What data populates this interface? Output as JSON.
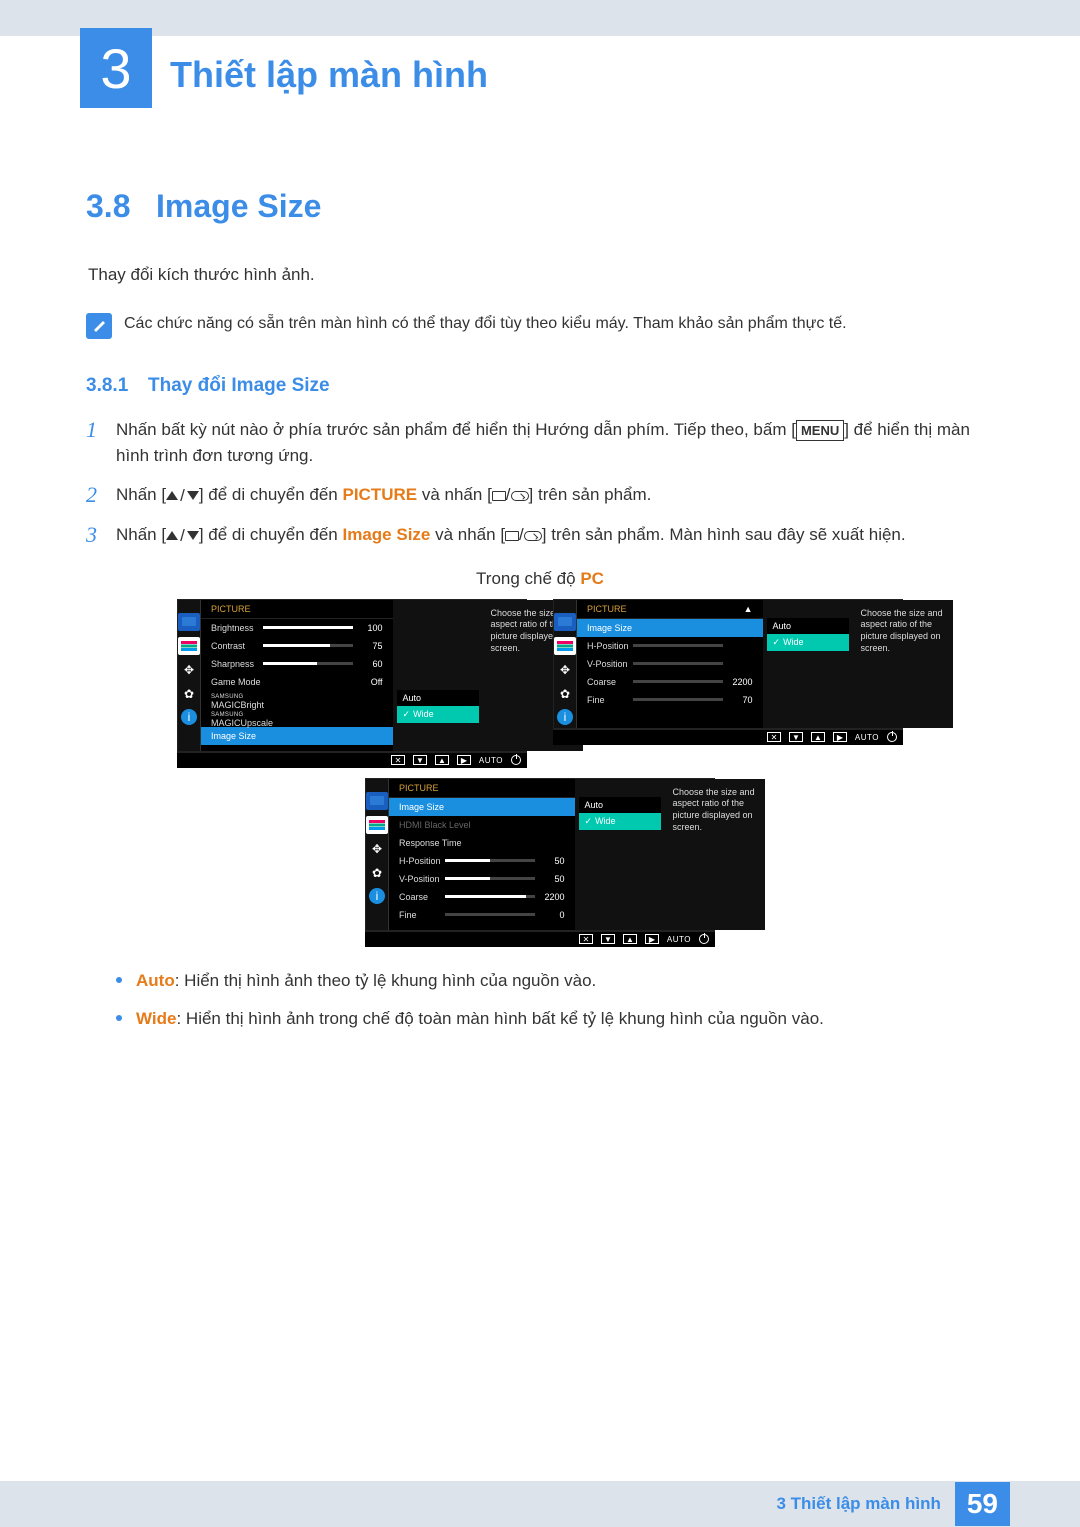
{
  "header": {
    "chapter_number": "3",
    "chapter_title": "Thiết lập màn hình"
  },
  "section": {
    "number": "3.8",
    "title": "Image Size",
    "description": "Thay đổi kích thước hình ảnh.",
    "note": "Các chức năng có sẵn trên màn hình có thể thay đổi tùy theo kiểu máy. Tham khảo sản phẩm thực tế."
  },
  "subsection": {
    "number": "3.8.1",
    "title": "Thay đổi Image Size"
  },
  "steps": {
    "s1_a": "Nhấn bất kỳ nút nào ở phía trước sản phẩm để hiển thị Hướng dẫn phím. Tiếp theo, bấm [",
    "s1_menu": "MENU",
    "s1_b": "] để hiển thị màn hình trình đơn tương ứng.",
    "s2_a": "Nhấn [",
    "s2_b": "] để di chuyển đến ",
    "s2_picture": "PICTURE",
    "s2_c": " và nhấn [",
    "s2_d": "] trên sản phẩm.",
    "s3_a": "Nhấn [",
    "s3_b": "] để di chuyển đến ",
    "s3_image": "Image Size",
    "s3_c": " và nhấn [",
    "s3_d": "] trên sản phẩm. Màn hình sau đây sẽ xuất hiện."
  },
  "mode_line": {
    "prefix": "Trong chế độ ",
    "mode": "PC"
  },
  "osd_desc": "Choose the size and aspect ratio of the picture displayed on screen.",
  "osd_foot_auto": "AUTO",
  "osd1": {
    "title": "PICTURE",
    "rows": [
      {
        "label": "Brightness",
        "bar": 100,
        "value": "100"
      },
      {
        "label": "Contrast",
        "bar": 75,
        "value": "75"
      },
      {
        "label": "Sharpness",
        "bar": 60,
        "value": "60"
      },
      {
        "label": "Game Mode",
        "text": "Off"
      }
    ],
    "magic1": "MAGICBright",
    "magic2": "MAGICUpscale",
    "sel_label": "Image Size",
    "opts": {
      "opt1": "Auto",
      "opt2": "Wide"
    },
    "opt_val": "Auto"
  },
  "osd2": {
    "title": "PICTURE",
    "sel_label": "Image Size",
    "rows": [
      {
        "label": "H-Position"
      },
      {
        "label": "V-Position"
      },
      {
        "label": "Coarse",
        "value": "2200"
      },
      {
        "label": "Fine",
        "value": "70"
      }
    ],
    "opts": {
      "opt1": "Auto",
      "opt2": "Wide"
    }
  },
  "osd3": {
    "title": "PICTURE",
    "sel_label": "Image Size",
    "dim_label": "HDMI Black Level",
    "rows": [
      {
        "label": "Response Time"
      },
      {
        "label": "H-Position",
        "bar": 50,
        "value": "50"
      },
      {
        "label": "V-Position",
        "bar": 50,
        "value": "50"
      },
      {
        "label": "Coarse",
        "value": "2200"
      },
      {
        "label": "Fine",
        "bar": 0,
        "value": "0"
      }
    ],
    "opts": {
      "opt1": "Auto",
      "opt2": "Wide"
    }
  },
  "bullets": {
    "b1_kw": "Auto",
    "b1_text": ": Hiển thị hình ảnh theo tỷ lệ khung hình của nguồn vào.",
    "b2_kw": "Wide",
    "b2_text": ": Hiển thị hình ảnh trong chế độ toàn màn hình bất kể tỷ lệ khung hình của nguồn vào."
  },
  "footer": {
    "chapter_label": "3 Thiết lập màn hình",
    "page_number": "59"
  }
}
